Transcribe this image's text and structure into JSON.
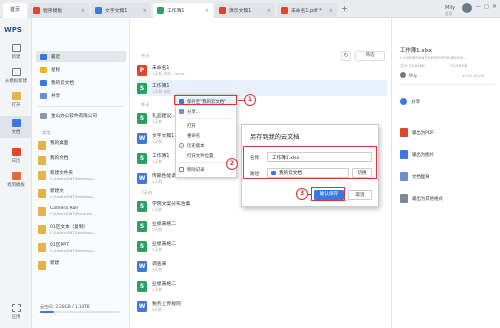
{
  "tabs": {
    "home": "首页",
    "items": [
      {
        "label": "程序模板",
        "color": "#e0452a"
      },
      {
        "label": "文字文稿1",
        "color": "#3a79e0"
      },
      {
        "label": "工作簿1",
        "color": "#2aa061"
      },
      {
        "label": "演示文稿1",
        "color": "#e0452a"
      },
      {
        "label": "未命名1.pdf *",
        "color": "#e0452a"
      }
    ],
    "close": "×",
    "add": "+"
  },
  "window": {
    "min": "—",
    "max": "□",
    "close": "×",
    "user": "Mily",
    "user_sub": "会员"
  },
  "rail": {
    "logo": "WPS",
    "items": [
      "新建",
      "从模板新建",
      "打开",
      "文档",
      "日历",
      "找到模板",
      "应用"
    ]
  },
  "search": {
    "placeholder": "搜索文件、模板、命令、插件"
  },
  "sidebar": {
    "items": [
      "最近",
      "星标",
      "我的云文档",
      "共享"
    ],
    "team": "金山办公软件有限公司",
    "section": "常用",
    "folders": [
      {
        "name": "我的桌面",
        "path": ""
      },
      {
        "name": "我的文档",
        "path": ""
      },
      {
        "name": "新建文件夹",
        "path": "C:\\Users\\SNT\\Desktop\\..."
      },
      {
        "name": "新建文",
        "path": "C:\\Users\\SNT\\Desktop\\..."
      },
      {
        "name": "Camera Roll",
        "path": "C:\\Users\\SNT\\Pictures\\..."
      },
      {
        "name": "01区文本（复制）",
        "path": "C:\\Users\\SNT\\Desktop\\..."
      },
      {
        "name": "01区PPT",
        "path": "C:\\Users\\SNT\\Desktop\\..."
      },
      {
        "name": "新建",
        "path": ""
      }
    ],
    "storage": "云空间: 3.28GB / 1.10TB"
  },
  "main": {
    "section_today": "今天",
    "section_yesterday": "昨天",
    "section_earlier": "7天内",
    "refresh": "↻",
    "filter": "筛选",
    "files": [
      {
        "name": "未命名1",
        "sub": "1天前  本地 · temp",
        "type": "P",
        "color": "#e0452a"
      },
      {
        "name": "工作簿1",
        "sub": "1天前  本地",
        "type": "S",
        "color": "#2aa061"
      },
      {
        "name": "礼品建议...",
        "sub": "1天前",
        "type": "S",
        "color": "#2aa061"
      },
      {
        "name": "文字文稿1",
        "sub": "1天前",
        "type": "W",
        "color": "#3a79e0"
      },
      {
        "name": "工作簿1",
        "sub": "1天前",
        "type": "S",
        "color": "#2aa061"
      },
      {
        "name": "传输性能调查：WebS视图播放...",
        "sub": "1天前",
        "type": "W",
        "color": "#3a79e0"
      },
      {
        "name": "学院文案分布合集",
        "sub": "2天前",
        "type": "S",
        "color": "#2aa061"
      },
      {
        "name": "业绩表格二",
        "sub": "2天前",
        "type": "S",
        "color": "#2aa061"
      },
      {
        "name": "业绩表格二",
        "sub": "3天前",
        "type": "S",
        "color": "#2aa061"
      },
      {
        "name": "调查表",
        "sub": "3天前",
        "type": "W",
        "color": "#3a79e0"
      },
      {
        "name": "业绩表格二",
        "sub": "4天前",
        "type": "S",
        "color": "#2aa061"
      },
      {
        "name": "税务上传规则",
        "sub": "5天前",
        "type": "W",
        "color": "#3a79e0"
      }
    ]
  },
  "context_menu": {
    "items": [
      "保存至\"我的云文档\"",
      "分享...",
      "打开",
      "重命名",
      "历史版本",
      "打开文件位置",
      "移除记录"
    ]
  },
  "dialog": {
    "title": "另存到我的云文档",
    "name_label": "名称:",
    "name_value": "工作簿1.xlsx",
    "location_label": "路径:",
    "location_value": "我的云文档",
    "switch": "切换",
    "confirm": "确认保存",
    "cancel": "取消"
  },
  "badges": [
    "1",
    "2",
    "3"
  ],
  "right_panel": {
    "title": "工作簿1.xlsx",
    "path": "C:\\USERS\\SNT\\DESKTOP\\SUBOOK...",
    "size_label": "大小 25.84KB",
    "modified": "13.58 KB",
    "owner_label": "Mily",
    "owner_date": "2019-10-09",
    "share_title": "分享",
    "actions": [
      "输出为PDF",
      "输出为图片",
      "文档瘦身",
      "输出为其他格式"
    ]
  }
}
